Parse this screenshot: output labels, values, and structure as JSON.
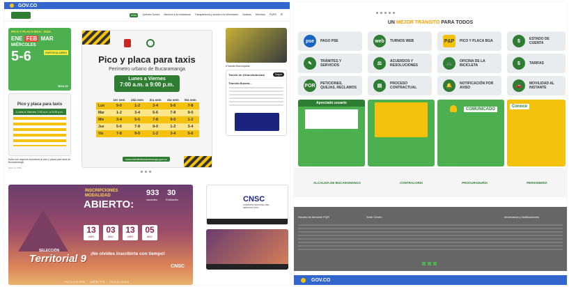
{
  "left_page": {
    "gov_label": "GOV.CO",
    "nav_items": [
      "Inicio",
      "Quiénes Somos",
      "Atención a la ciudadanía",
      "Transparencia y acceso a la información",
      "Noticias",
      "Servicios",
      "PQRS",
      "☰"
    ],
    "active_nav": "Inicio",
    "banner_left": {
      "title": "PICO Y PLACA BGA - 2023",
      "months": [
        "ENE",
        "FEB",
        "MAR"
      ],
      "day": "MIÉRCOLES",
      "digits": "5-6",
      "badge": "PARTICULARES",
      "tag": "BGA-01"
    },
    "banner_left2": {
      "title": "Pico y placa para taxis",
      "subtitle": "Lunes a Viernes 7:00 a.m. a 9:00 p.m.",
      "caption": "Estos son algunos incentivos al pico y placa para taxis de Bucaramanga",
      "date": "Enero 2, 2023"
    },
    "main_banner": {
      "title": "Pico y placa para taxis",
      "subtitle": "Perímetro urbano de Bucaramanga",
      "schedule_line1": "Lunes a Viernes",
      "schedule_line2": "7:00 a.m. a 9:00 p.m.",
      "columns": [
        "1er sem",
        "2da sem",
        "3ra sem",
        "4ta sem",
        "5ta sem"
      ],
      "rows": [
        {
          "day": "Lun",
          "values": [
            "9-0",
            "1-2",
            "3-4",
            "5-6",
            "7-8"
          ]
        },
        {
          "day": "Mar",
          "values": [
            "1-2",
            "3-4",
            "5-6",
            "7-8",
            "9-0"
          ]
        },
        {
          "day": "Mie",
          "values": [
            "3-4",
            "5-6",
            "7-8",
            "9-0",
            "1-2"
          ]
        },
        {
          "day": "Jue",
          "values": [
            "5-6",
            "7-8",
            "9-0",
            "1-2",
            "3-4"
          ]
        },
        {
          "day": "Vie",
          "values": [
            "7-8",
            "9-0",
            "1-2",
            "3-4",
            "5-6"
          ]
        }
      ],
      "footer": "www.transitobucaramanga.gov.co"
    },
    "twitter": {
      "caption": "#TransitoTeacompaña",
      "header": "Tweets de @transitobucara",
      "follow": "Seguir",
      "account": "Tránsito Bucara..."
    },
    "cnsc_banner": {
      "title1": "INSCRIPCIONES",
      "title2": "MODALIDAD",
      "title3": "ABIERTO:",
      "vacantes_num": "933",
      "vacantes_label": "vacantes",
      "entidades_num": "30",
      "entidades_label": "Entidades",
      "dates": [
        "13",
        "03",
        "13",
        "05"
      ],
      "months": [
        "ABR",
        "MAY",
        "ABR",
        "MAY"
      ],
      "seleccion": "SELECCIÓN",
      "territorial": "Territorial 9",
      "no_olvides": "¡No olvides inscribirte con tiempo!",
      "logo": "CNSC",
      "bottom": "INCLUSIÓN · MÉRITO · IGUALDAD"
    },
    "cnsc_video": {
      "logo": "CNSC",
      "subtitle": "COMISIÓN NACIONAL DEL SERVICIO CIVIL"
    }
  },
  "right_page": {
    "heading_prefix": "UN ",
    "heading_highlight": "MEJOR TRÁNSITO",
    "heading_suffix": " PARA TODOS",
    "services": [
      {
        "icon": "pse",
        "label": "PAGO PSE"
      },
      {
        "icon": "web",
        "label": "TURNOS WEB"
      },
      {
        "icon": "P&P",
        "label": "PICO Y PLACA BGA"
      },
      {
        "icon": "$",
        "label": "ESTADO DE CUENTA"
      },
      {
        "icon": "✎",
        "label": "TRÁMITES Y SERVICIOS"
      },
      {
        "icon": "⚖",
        "label": "ACUERDOS Y RESOLUCIONES"
      },
      {
        "icon": "🚲",
        "label": "OFICINA DE LA BICICLETA"
      },
      {
        "icon": "$",
        "label": "TARIFAS"
      },
      {
        "icon": "POR",
        "label": "PETICIONES, QUEJAS, RECLAMOS"
      },
      {
        "icon": "▤",
        "label": "PROCESO CONTRACTUAL"
      },
      {
        "icon": "🔔",
        "label": "NOTIFICACIÓN POR AVISO"
      },
      {
        "icon": "🚗",
        "label": "MOVILIDAD AL INSTANTE"
      }
    ],
    "promo1": "Apreciado usuario",
    "promo3": "COMUNICADO",
    "promo4": "Conoce",
    "logos": [
      "ALCALDÍA DE BUCARAMANGA",
      "CONTRALORÍA",
      "PROCURADURÍA",
      "PERSONERÍA"
    ],
    "footer": {
      "col1_title": "Horario de Atención PQR",
      "col2_title": "Sede Centro",
      "col3_title": "Información y Notificaciones"
    },
    "bottom_label": "GOV.CO"
  },
  "colors": {
    "gov_blue": "#3366cc",
    "brand_green": "#2e7d32",
    "brand_yellow": "#f4c20d"
  }
}
